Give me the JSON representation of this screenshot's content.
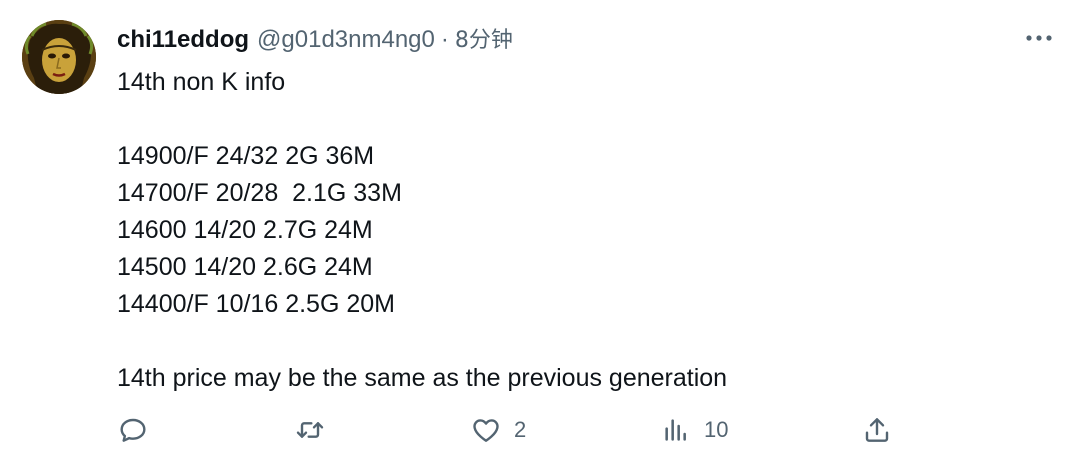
{
  "tweet": {
    "display_name": "chi11eddog",
    "handle": "@g01d3nm4ng0",
    "separator": "·",
    "time": "8分钟",
    "lines": [
      "14th non K info",
      "",
      "14900/F 24/32 2G 36M",
      "14700/F 20/28  2.1G 33M",
      "14600 14/20 2.7G 24M",
      "14500 14/20 2.6G 24M",
      "14400/F 10/16 2.5G 20M",
      "",
      "14th price may be the same as the previous generation"
    ]
  },
  "actions": {
    "reply_icon": "reply-icon",
    "retweet_icon": "retweet-icon",
    "like_icon": "heart-icon",
    "like_count": "2",
    "views_icon": "views-icon",
    "views_count": "10",
    "share_icon": "share-icon",
    "more_icon": "more-icon"
  },
  "colors": {
    "text": "#0f1419",
    "secondary": "#536471"
  }
}
